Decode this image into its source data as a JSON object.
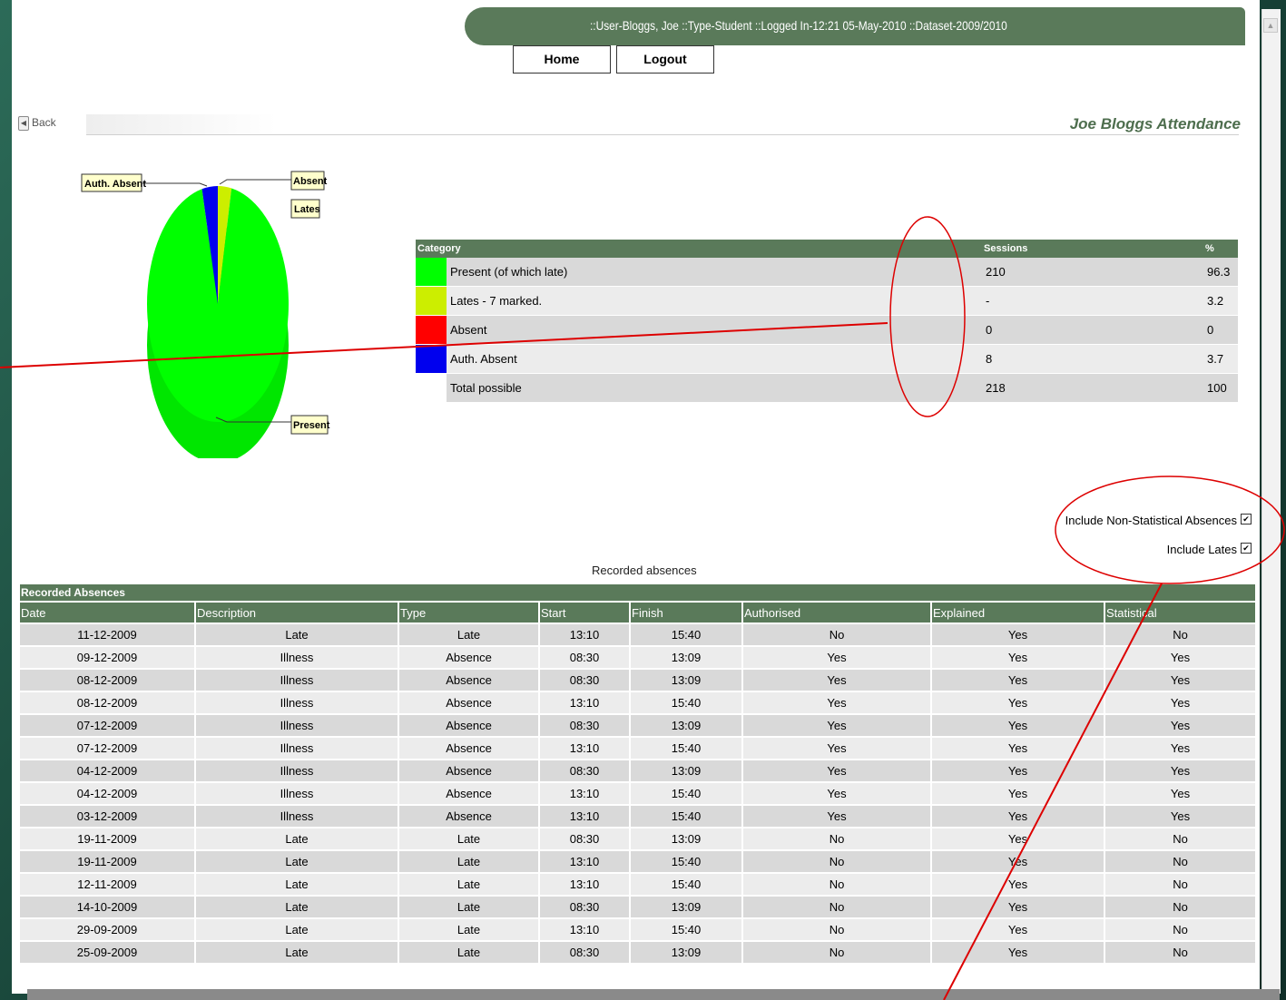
{
  "header": {
    "status_text": "::User-Bloggs, Joe  ::Type-Student  ::Logged In-12:21 05-May-2010  ::Dataset-2009/2010",
    "home_label": "Home",
    "logout_label": "Logout",
    "back_label": "Back",
    "page_title": "Joe Bloggs Attendance"
  },
  "pie_chart": {
    "labels": {
      "auth_absent": "Auth. Absent",
      "absent": "Absent",
      "lates": "Lates",
      "present": "Present"
    },
    "colors": {
      "present": "#00ff00",
      "lates": "#ccee00",
      "absent": "#ff0000",
      "auth_absent": "#0000ee"
    }
  },
  "chart_data": {
    "type": "pie",
    "labels": [
      "Present",
      "Lates",
      "Absent",
      "Auth. Absent"
    ],
    "values": [
      96.3,
      3.2,
      0,
      3.7
    ],
    "colors": [
      "#00ff00",
      "#ccee00",
      "#ff0000",
      "#0000ee"
    ]
  },
  "summary": {
    "headers": [
      "Category",
      "Sessions",
      "%"
    ],
    "rows": [
      {
        "color": "#00ff00",
        "category": "Present (of which late)",
        "sessions": "210",
        "percent": "96.3"
      },
      {
        "color": "#ccee00",
        "category": "Lates - 7 marked.",
        "sessions": "-",
        "percent": "3.2"
      },
      {
        "color": "#ff0000",
        "category": "Absent",
        "sessions": "0",
        "percent": "0"
      },
      {
        "color": "#0000ee",
        "category": "Auth. Absent",
        "sessions": "8",
        "percent": "3.7"
      },
      {
        "color": "",
        "category": "Total possible",
        "sessions": "218",
        "percent": "100"
      }
    ]
  },
  "filters": {
    "non_statistical_label": "Include Non-Statistical Absences",
    "non_statistical_checked": true,
    "lates_label": "Include Lates",
    "lates_checked": true
  },
  "absences": {
    "caption": "Recorded absences",
    "table_title": "Recorded Absences",
    "columns": [
      "Date",
      "Description",
      "Type",
      "Start",
      "Finish",
      "Authorised",
      "Explained",
      "Statistical"
    ],
    "rows": [
      [
        "11-12-2009",
        "Late",
        "Late",
        "13:10",
        "15:40",
        "No",
        "Yes",
        "No"
      ],
      [
        "09-12-2009",
        "Illness",
        "Absence",
        "08:30",
        "13:09",
        "Yes",
        "Yes",
        "Yes"
      ],
      [
        "08-12-2009",
        "Illness",
        "Absence",
        "08:30",
        "13:09",
        "Yes",
        "Yes",
        "Yes"
      ],
      [
        "08-12-2009",
        "Illness",
        "Absence",
        "13:10",
        "15:40",
        "Yes",
        "Yes",
        "Yes"
      ],
      [
        "07-12-2009",
        "Illness",
        "Absence",
        "08:30",
        "13:09",
        "Yes",
        "Yes",
        "Yes"
      ],
      [
        "07-12-2009",
        "Illness",
        "Absence",
        "13:10",
        "15:40",
        "Yes",
        "Yes",
        "Yes"
      ],
      [
        "04-12-2009",
        "Illness",
        "Absence",
        "08:30",
        "13:09",
        "Yes",
        "Yes",
        "Yes"
      ],
      [
        "04-12-2009",
        "Illness",
        "Absence",
        "13:10",
        "15:40",
        "Yes",
        "Yes",
        "Yes"
      ],
      [
        "03-12-2009",
        "Illness",
        "Absence",
        "13:10",
        "15:40",
        "Yes",
        "Yes",
        "Yes"
      ],
      [
        "19-11-2009",
        "Late",
        "Late",
        "08:30",
        "13:09",
        "No",
        "Yes",
        "No"
      ],
      [
        "19-11-2009",
        "Late",
        "Late",
        "13:10",
        "15:40",
        "No",
        "Yes",
        "No"
      ],
      [
        "12-11-2009",
        "Late",
        "Late",
        "13:10",
        "15:40",
        "No",
        "Yes",
        "No"
      ],
      [
        "14-10-2009",
        "Late",
        "Late",
        "08:30",
        "13:09",
        "No",
        "Yes",
        "No"
      ],
      [
        "29-09-2009",
        "Late",
        "Late",
        "13:10",
        "15:40",
        "No",
        "Yes",
        "No"
      ],
      [
        "25-09-2009",
        "Late",
        "Late",
        "08:30",
        "13:09",
        "No",
        "Yes",
        "No"
      ]
    ]
  },
  "annotation_color": "#dd0000"
}
